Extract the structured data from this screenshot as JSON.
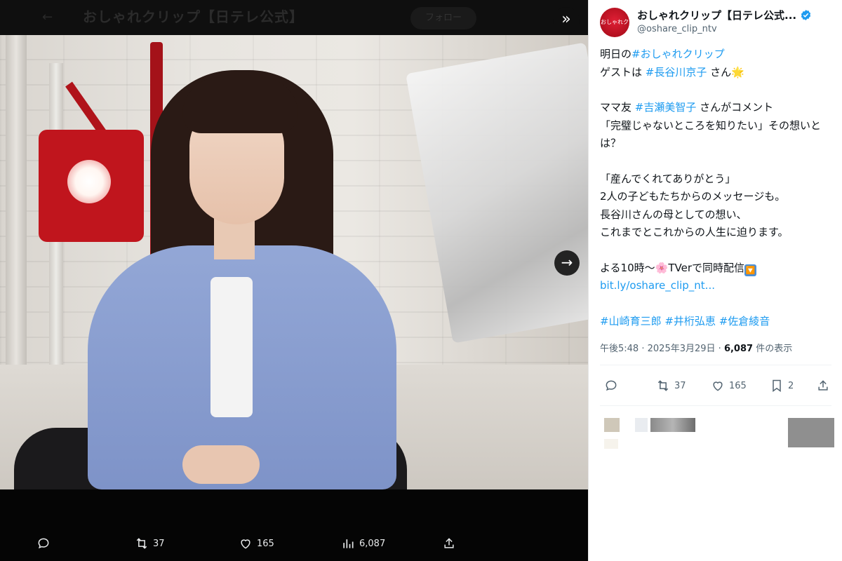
{
  "viewer": {
    "header_title": "おしゃれクリップ【日テレ公式】",
    "header_follow": "フォロー",
    "actions": {
      "reply_count": "",
      "retweet_count": "37",
      "like_count": "165",
      "views_count": "6,087",
      "share_count": ""
    }
  },
  "tweet": {
    "avatar_label": "おしゃれクリップ",
    "display_name": "おしゃれクリップ【日テレ公式...",
    "handle": "@oshare_clip_ntv",
    "lines": {
      "l1_prefix": "明日の",
      "l1_tag": "#おしゃれクリップ",
      "l2_prefix": "ゲストは",
      "l2_tag": "#長谷川京子",
      "l2_suffix": "さん",
      "l2_emoji": "🌟",
      "l3_prefix": "ママ友",
      "l3_tag": "#吉瀬美智子",
      "l3_suffix": "さんがコメント",
      "l4": "「完璧じゃないところを知りたい」その想いとは？",
      "l5": "「産んでくれてありがとう」",
      "l6": "2人の子どもたちからのメッセージも。",
      "l7": "長谷川さんの母としての想い、",
      "l8": "これまでとこれからの人生に迫ります。",
      "l9_prefix": "よる10時〜",
      "l9_emoji": "🌸",
      "l9_suffix": "TVerで同時配信",
      "l9_emoji2": "🔽",
      "link": "bit.ly/oshare_clip_nt...",
      "tags": [
        "#山崎育三郎",
        "#井桁弘恵",
        "#佐倉綾音"
      ]
    },
    "meta": {
      "time": "午後5:48",
      "sep": "·",
      "date": "2025年3月29日",
      "views_num": "6,087",
      "views_label": "件の表示"
    },
    "stats": {
      "retweets": "37",
      "likes": "165",
      "bookmarks": "2"
    }
  },
  "colors": {
    "accent": "#1d9bf0",
    "text": "#0f1419",
    "muted": "#536471",
    "jacket": "#8ea2d3",
    "lamp": "#c0151d"
  }
}
